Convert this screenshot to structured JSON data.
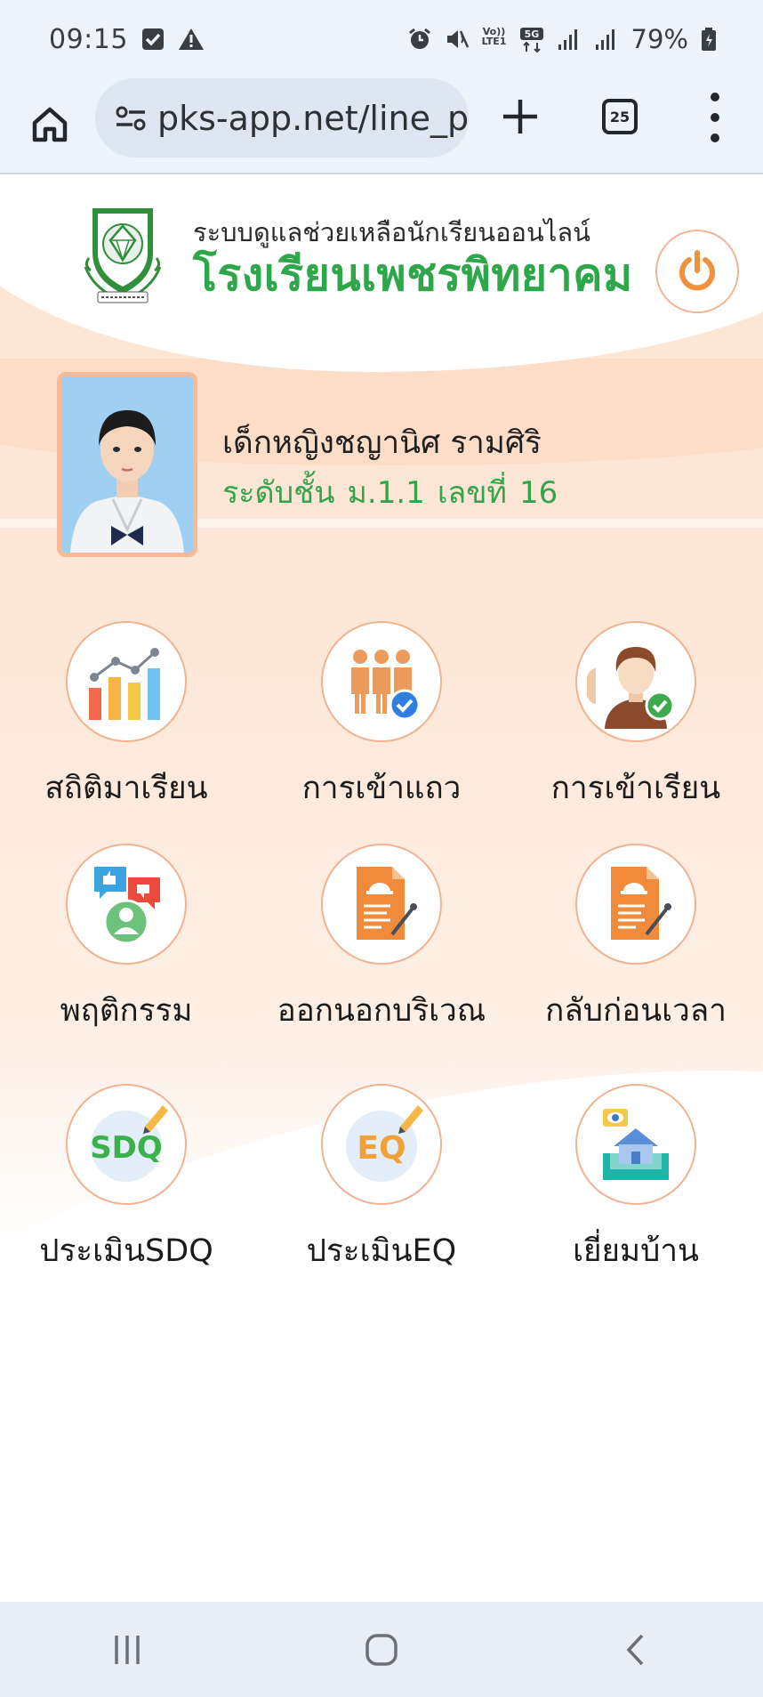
{
  "status_bar": {
    "time": "09:15",
    "network": "5G",
    "volte": "Vo)) LTE1",
    "battery": "79%"
  },
  "browser": {
    "url": "pks-app.net/line_p",
    "tab_count": "25"
  },
  "header": {
    "system_title": "ระบบดูแลช่วยเหลือนักเรียนออนไลน์",
    "school_name": "โรงเรียนเพชรพิทยาคม"
  },
  "student": {
    "name": "เด็กหญิงชญานิศ รามศิริ",
    "class_label": "ระดับชั้น",
    "class_value": "ม.1.1",
    "number_label": "เลขที่",
    "number_value": "16"
  },
  "menu": {
    "items": [
      {
        "label": "สถิติมาเรียน",
        "icon": "chart-icon"
      },
      {
        "label": "การเข้าแถว",
        "icon": "line-up-icon"
      },
      {
        "label": "การเข้าเรียน",
        "icon": "attendance-icon"
      },
      {
        "label": "พฤติกรรม",
        "icon": "behavior-icon"
      },
      {
        "label": "ออกนอกบริเวณ",
        "icon": "leave-campus-icon"
      },
      {
        "label": "กลับก่อนเวลา",
        "icon": "early-leave-icon"
      },
      {
        "label": "ประเมินSDQ",
        "icon": "sdq-icon"
      },
      {
        "label": "ประเมินEQ",
        "icon": "eq-icon"
      },
      {
        "label": "เยี่ยมบ้าน",
        "icon": "home-visit-icon"
      }
    ]
  },
  "icon_text": {
    "sdq": "SDQ",
    "eq": "EQ"
  },
  "colors": {
    "accent_green": "#2ea64a",
    "accent_orange": "#f0913c",
    "circle_border": "#f0b391"
  }
}
